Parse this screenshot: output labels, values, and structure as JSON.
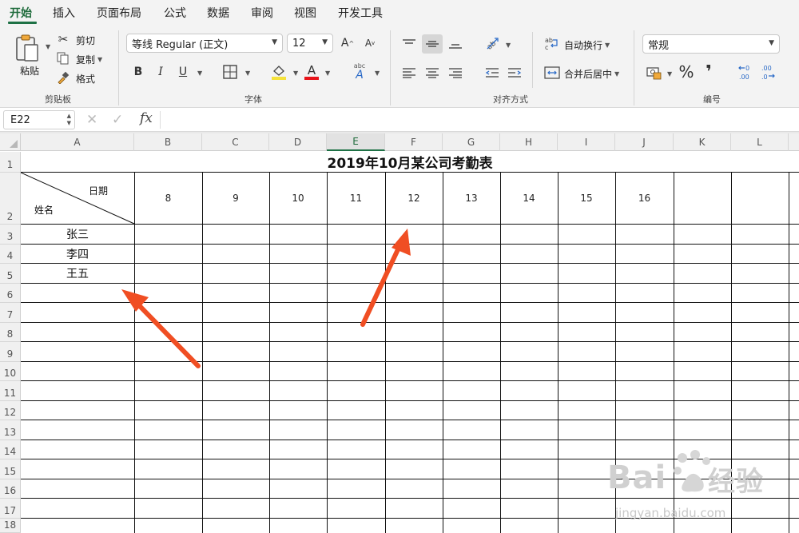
{
  "ribbon_tabs": [
    {
      "label": "开始",
      "active": true
    },
    {
      "label": "插入"
    },
    {
      "label": "页面布局"
    },
    {
      "label": "公式"
    },
    {
      "label": "数据"
    },
    {
      "label": "审阅"
    },
    {
      "label": "视图"
    },
    {
      "label": "开发工具"
    }
  ],
  "clipboard": {
    "group_label": "剪贴板",
    "paste": "粘贴",
    "cut": "剪切",
    "copy": "复制",
    "format_painter": "格式"
  },
  "font": {
    "group_label": "字体",
    "font_name": "等线 Regular (正文)",
    "font_size": "12",
    "bold": "B",
    "italic": "I",
    "underline": "U",
    "font_color_letter": "A",
    "fill_color": "#f5e23a",
    "font_color": "#e8141a"
  },
  "alignment": {
    "group_label": "对齐方式",
    "wrap_text": "自动换行",
    "merge_center": "合并后居中"
  },
  "number": {
    "group_label": "编号",
    "format": "常规",
    "percent": "%",
    "comma": "❜"
  },
  "formula_bar": {
    "name_box": "E22",
    "fx": "fx"
  },
  "columns": [
    "A",
    "B",
    "C",
    "D",
    "E",
    "F",
    "G",
    "H",
    "I",
    "J",
    "K",
    "L"
  ],
  "selected_column": "E",
  "rows": [
    "1",
    "2",
    "3",
    "4",
    "5",
    "6",
    "7",
    "8",
    "9",
    "10",
    "11",
    "12",
    "13",
    "14",
    "15",
    "16",
    "17",
    "18"
  ],
  "sheet": {
    "title": "2019年10月某公司考勤表",
    "header_date": "日期",
    "header_name": "姓名",
    "days": [
      "8",
      "9",
      "10",
      "11",
      "12",
      "13",
      "14",
      "15",
      "16"
    ],
    "names": [
      "张三",
      "李四",
      "王五"
    ]
  },
  "arrow_color": "#f04e23",
  "watermark": {
    "text": "Bai",
    "suffix": "经验",
    "url": "jingyan.baidu.com"
  }
}
